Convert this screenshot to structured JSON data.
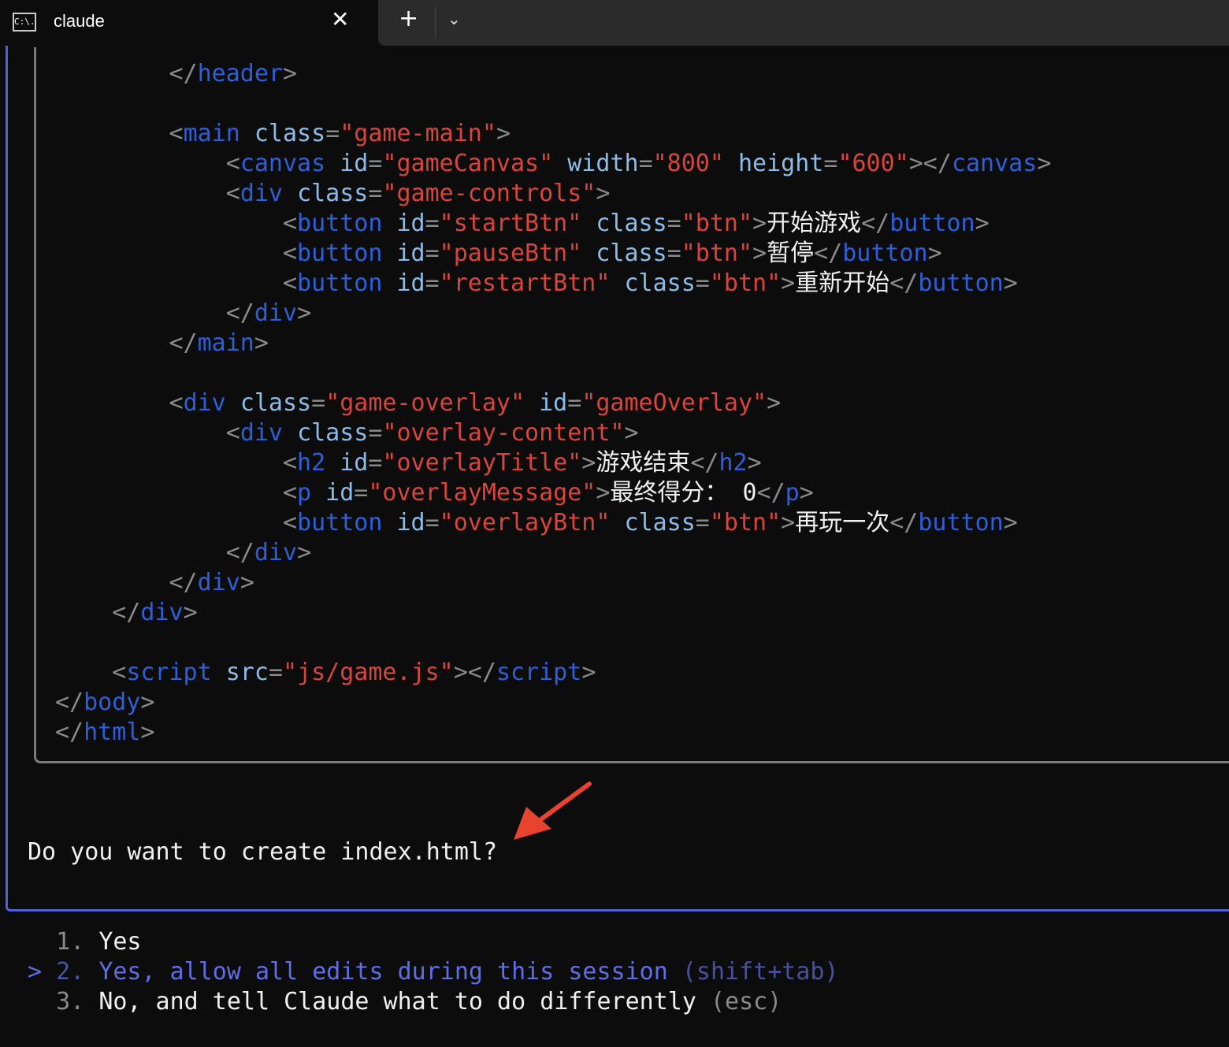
{
  "tab": {
    "icon": "terminal-icon",
    "icon_text": "C:\\.",
    "title": "claude",
    "close": "✕",
    "new_tab": "+",
    "dropdown": "⌄"
  },
  "code_lines": [
    [
      [
        "p",
        "        </"
      ],
      [
        "t",
        "header"
      ],
      [
        "p",
        ">"
      ]
    ],
    [],
    [
      [
        "p",
        "        <"
      ],
      [
        "t",
        "main"
      ],
      [
        "x",
        " "
      ],
      [
        "a",
        "class"
      ],
      [
        "p",
        "="
      ],
      [
        "s",
        "\"game-main\""
      ],
      [
        "p",
        ">"
      ]
    ],
    [
      [
        "p",
        "            <"
      ],
      [
        "t",
        "canvas"
      ],
      [
        "x",
        " "
      ],
      [
        "a",
        "id"
      ],
      [
        "p",
        "="
      ],
      [
        "s",
        "\"gameCanvas\""
      ],
      [
        "x",
        " "
      ],
      [
        "a",
        "width"
      ],
      [
        "p",
        "="
      ],
      [
        "s",
        "\"800\""
      ],
      [
        "x",
        " "
      ],
      [
        "a",
        "height"
      ],
      [
        "p",
        "="
      ],
      [
        "s",
        "\"600\""
      ],
      [
        "p",
        "></"
      ],
      [
        "t",
        "canvas"
      ],
      [
        "p",
        ">"
      ]
    ],
    [
      [
        "p",
        "            <"
      ],
      [
        "t",
        "div"
      ],
      [
        "x",
        " "
      ],
      [
        "a",
        "class"
      ],
      [
        "p",
        "="
      ],
      [
        "s",
        "\"game-controls\""
      ],
      [
        "p",
        ">"
      ]
    ],
    [
      [
        "p",
        "                <"
      ],
      [
        "t",
        "button"
      ],
      [
        "x",
        " "
      ],
      [
        "a",
        "id"
      ],
      [
        "p",
        "="
      ],
      [
        "s",
        "\"startBtn\""
      ],
      [
        "x",
        " "
      ],
      [
        "a",
        "class"
      ],
      [
        "p",
        "="
      ],
      [
        "s",
        "\"btn\""
      ],
      [
        "p",
        ">"
      ],
      [
        "x",
        "开始游戏"
      ],
      [
        "p",
        "</"
      ],
      [
        "t",
        "button"
      ],
      [
        "p",
        ">"
      ]
    ],
    [
      [
        "p",
        "                <"
      ],
      [
        "t",
        "button"
      ],
      [
        "x",
        " "
      ],
      [
        "a",
        "id"
      ],
      [
        "p",
        "="
      ],
      [
        "s",
        "\"pauseBtn\""
      ],
      [
        "x",
        " "
      ],
      [
        "a",
        "class"
      ],
      [
        "p",
        "="
      ],
      [
        "s",
        "\"btn\""
      ],
      [
        "p",
        ">"
      ],
      [
        "x",
        "暂停"
      ],
      [
        "p",
        "</"
      ],
      [
        "t",
        "button"
      ],
      [
        "p",
        ">"
      ]
    ],
    [
      [
        "p",
        "                <"
      ],
      [
        "t",
        "button"
      ],
      [
        "x",
        " "
      ],
      [
        "a",
        "id"
      ],
      [
        "p",
        "="
      ],
      [
        "s",
        "\"restartBtn\""
      ],
      [
        "x",
        " "
      ],
      [
        "a",
        "class"
      ],
      [
        "p",
        "="
      ],
      [
        "s",
        "\"btn\""
      ],
      [
        "p",
        ">"
      ],
      [
        "x",
        "重新开始"
      ],
      [
        "p",
        "</"
      ],
      [
        "t",
        "button"
      ],
      [
        "p",
        ">"
      ]
    ],
    [
      [
        "p",
        "            </"
      ],
      [
        "t",
        "div"
      ],
      [
        "p",
        ">"
      ]
    ],
    [
      [
        "p",
        "        </"
      ],
      [
        "t",
        "main"
      ],
      [
        "p",
        ">"
      ]
    ],
    [],
    [
      [
        "p",
        "        <"
      ],
      [
        "t",
        "div"
      ],
      [
        "x",
        " "
      ],
      [
        "a",
        "class"
      ],
      [
        "p",
        "="
      ],
      [
        "s",
        "\"game-overlay\""
      ],
      [
        "x",
        " "
      ],
      [
        "a",
        "id"
      ],
      [
        "p",
        "="
      ],
      [
        "s",
        "\"gameOverlay\""
      ],
      [
        "p",
        ">"
      ]
    ],
    [
      [
        "p",
        "            <"
      ],
      [
        "t",
        "div"
      ],
      [
        "x",
        " "
      ],
      [
        "a",
        "class"
      ],
      [
        "p",
        "="
      ],
      [
        "s",
        "\"overlay-content\""
      ],
      [
        "p",
        ">"
      ]
    ],
    [
      [
        "p",
        "                <"
      ],
      [
        "t",
        "h2"
      ],
      [
        "x",
        " "
      ],
      [
        "a",
        "id"
      ],
      [
        "p",
        "="
      ],
      [
        "s",
        "\"overlayTitle\""
      ],
      [
        "p",
        ">"
      ],
      [
        "x",
        "游戏结束"
      ],
      [
        "p",
        "</"
      ],
      [
        "t",
        "h2"
      ],
      [
        "p",
        ">"
      ]
    ],
    [
      [
        "p",
        "                <"
      ],
      [
        "t",
        "p"
      ],
      [
        "x",
        " "
      ],
      [
        "a",
        "id"
      ],
      [
        "p",
        "="
      ],
      [
        "s",
        "\"overlayMessage\""
      ],
      [
        "p",
        ">"
      ],
      [
        "x",
        "最终得分： 0"
      ],
      [
        "p",
        "</"
      ],
      [
        "t",
        "p"
      ],
      [
        "p",
        ">"
      ]
    ],
    [
      [
        "p",
        "                <"
      ],
      [
        "t",
        "button"
      ],
      [
        "x",
        " "
      ],
      [
        "a",
        "id"
      ],
      [
        "p",
        "="
      ],
      [
        "s",
        "\"overlayBtn\""
      ],
      [
        "x",
        " "
      ],
      [
        "a",
        "class"
      ],
      [
        "p",
        "="
      ],
      [
        "s",
        "\"btn\""
      ],
      [
        "p",
        ">"
      ],
      [
        "x",
        "再玩一次"
      ],
      [
        "p",
        "</"
      ],
      [
        "t",
        "button"
      ],
      [
        "p",
        ">"
      ]
    ],
    [
      [
        "p",
        "            </"
      ],
      [
        "t",
        "div"
      ],
      [
        "p",
        ">"
      ]
    ],
    [
      [
        "p",
        "        </"
      ],
      [
        "t",
        "div"
      ],
      [
        "p",
        ">"
      ]
    ],
    [
      [
        "p",
        "    </"
      ],
      [
        "t",
        "div"
      ],
      [
        "p",
        ">"
      ]
    ],
    [],
    [
      [
        "p",
        "    <"
      ],
      [
        "t",
        "script"
      ],
      [
        "x",
        " "
      ],
      [
        "a",
        "src"
      ],
      [
        "p",
        "="
      ],
      [
        "s",
        "\"js/game.js\""
      ],
      [
        "p",
        "></"
      ],
      [
        "t",
        "script"
      ],
      [
        "p",
        ">"
      ]
    ],
    [
      [
        "p",
        "</"
      ],
      [
        "t",
        "body"
      ],
      [
        "p",
        ">"
      ]
    ],
    [
      [
        "p",
        "</"
      ],
      [
        "t",
        "html"
      ],
      [
        "p",
        ">"
      ]
    ]
  ],
  "prompt": {
    "question": "Do you want to create index.html?",
    "cursor": ">",
    "options": [
      {
        "num": "1.",
        "label": "Yes",
        "hint": ""
      },
      {
        "num": "2.",
        "label": "Yes, allow all edits during this session",
        "hint": "(shift+tab)"
      },
      {
        "num": "3.",
        "label": "No, and tell Claude what to do differently",
        "hint": "(esc)"
      }
    ],
    "selected_index": 1
  },
  "colors": {
    "tag": "#2f5fd6",
    "attr": "#8cbbe8",
    "string": "#d8453c",
    "punct": "#8a8a8a",
    "selected": "#5e6ee6",
    "annotation_arrow": "#e8432e"
  }
}
